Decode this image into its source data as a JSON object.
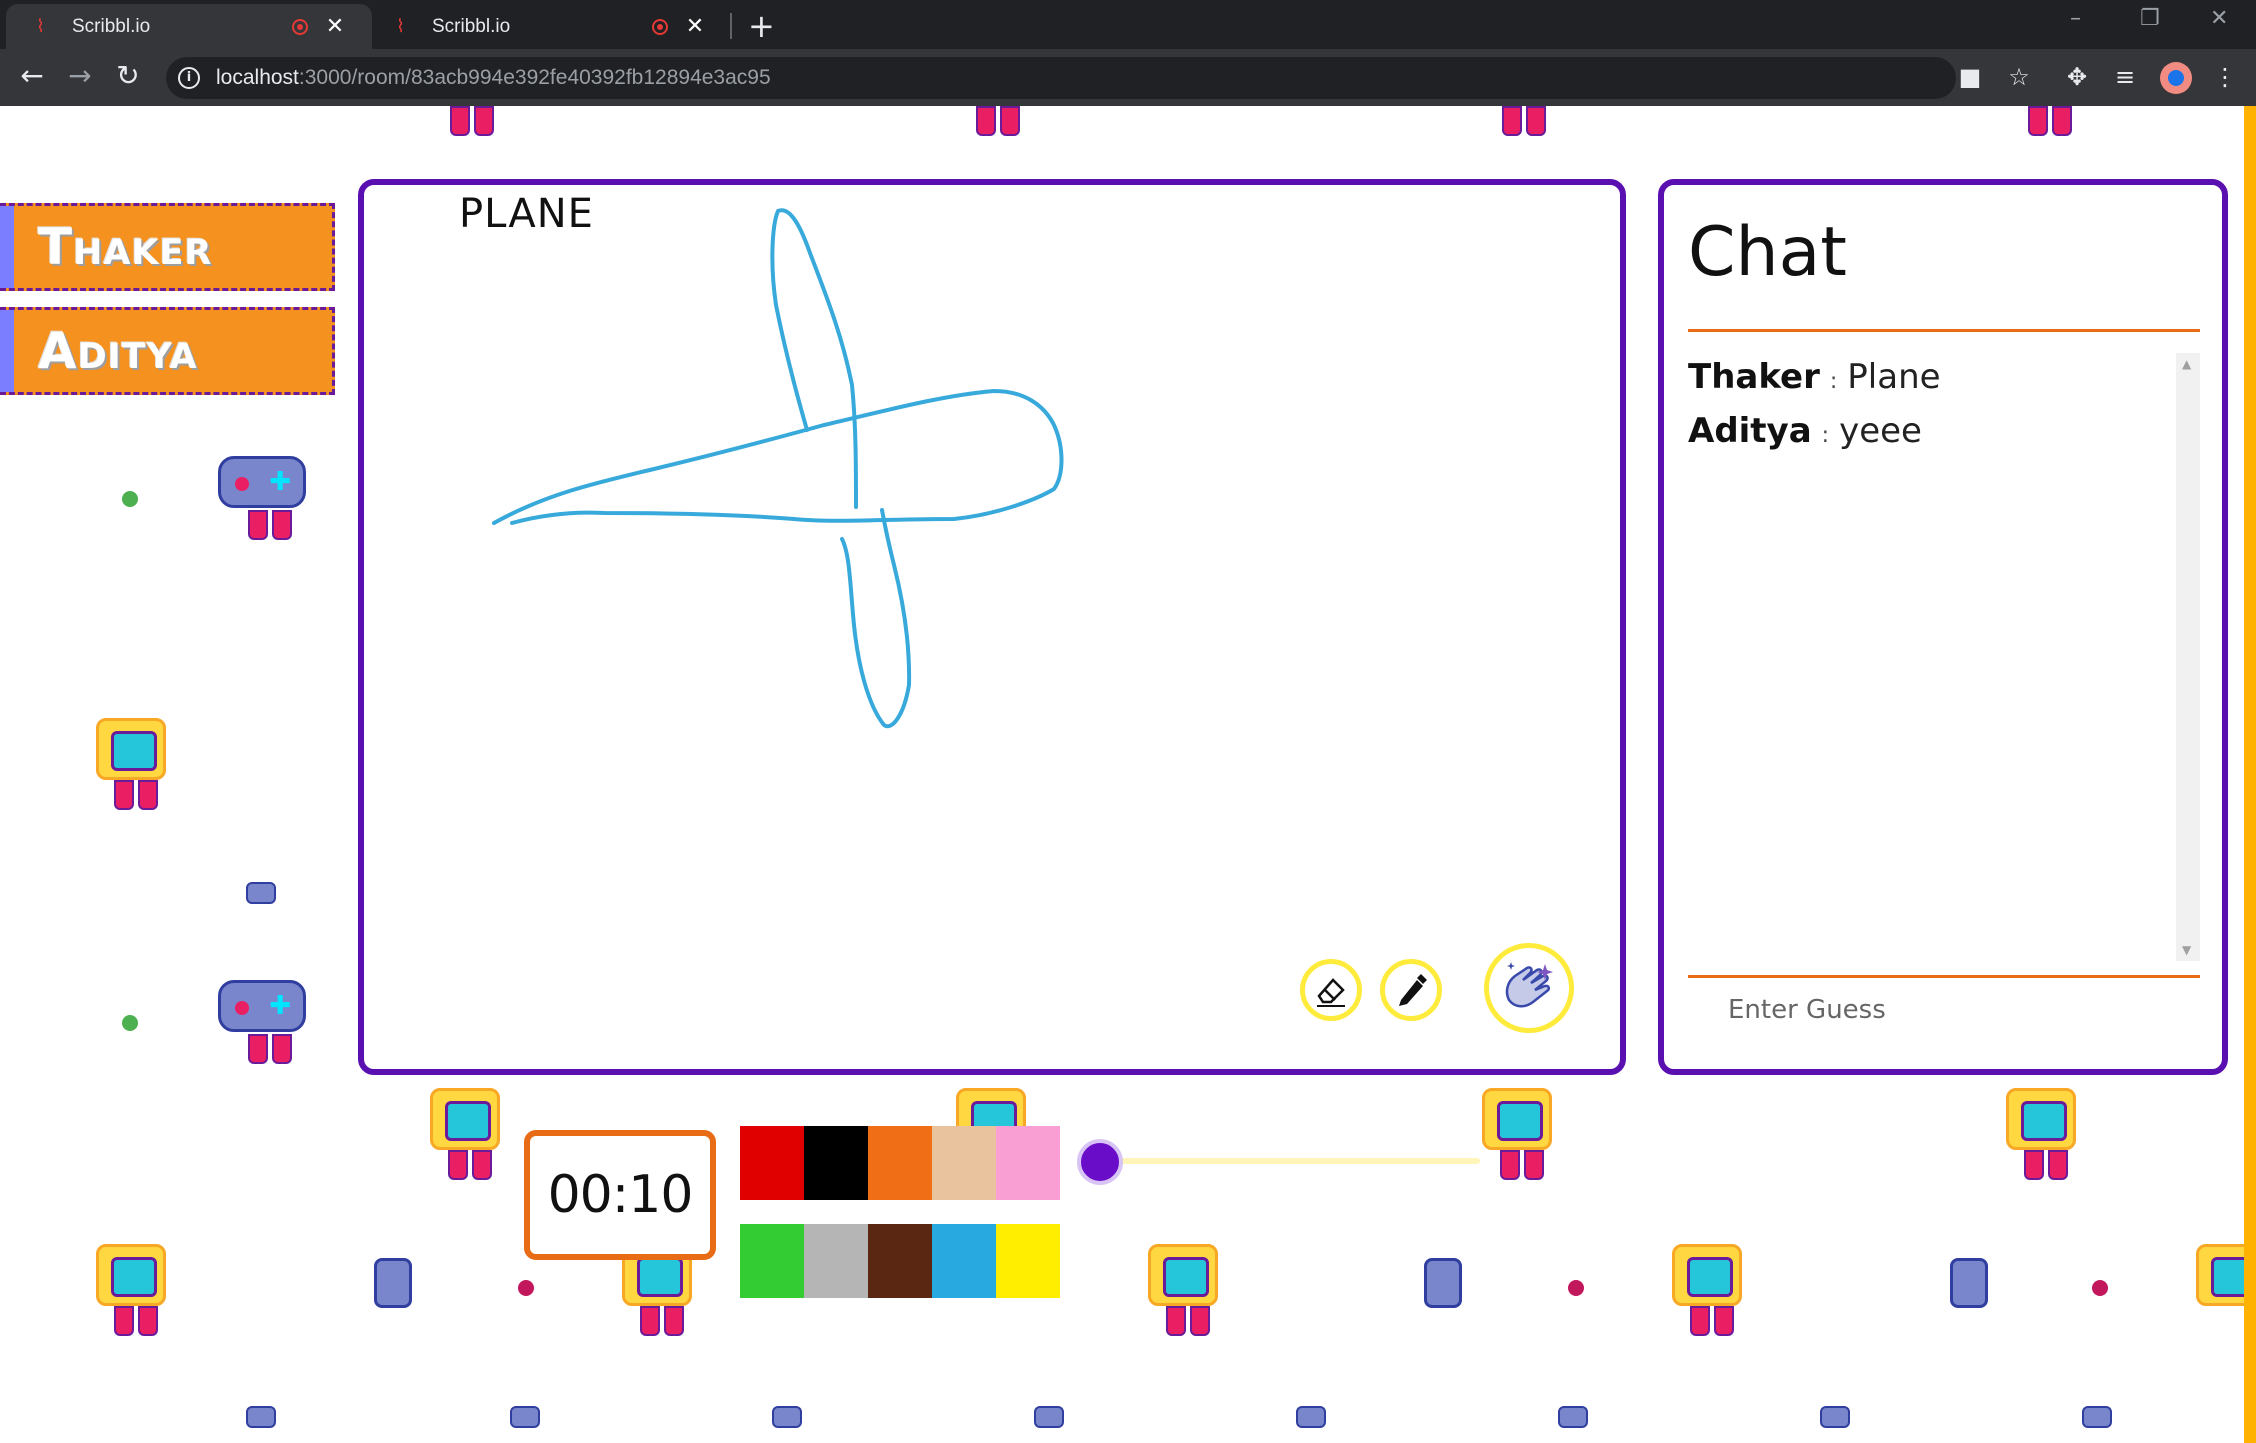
{
  "browser": {
    "tabs": [
      {
        "title": "Scribbl.io",
        "active": true
      },
      {
        "title": "Scribbl.io",
        "active": false
      }
    ],
    "url_host": "localhost",
    "url_path": ":3000/room/83acb994e392fe40392fb12894e3ac95"
  },
  "players": [
    {
      "name": "Thaker"
    },
    {
      "name": "Aditya"
    }
  ],
  "canvas": {
    "word": "PLANE",
    "stroke_color": "#38a9db"
  },
  "chat": {
    "title": "Chat",
    "messages": [
      {
        "user": "Thaker",
        "separator": ":",
        "text": "Plane"
      },
      {
        "user": "Aditya",
        "separator": ":",
        "text": "yeee"
      }
    ],
    "input_placeholder": "Enter Guess"
  },
  "timer": {
    "value": "00:10"
  },
  "palette": {
    "colors": [
      "#e00000",
      "#000000",
      "#f06e15",
      "#e8c39e",
      "#fa9fd3",
      "#33cc33",
      "#b5b5b5",
      "#5a2713",
      "#28a9e0",
      "#ffee00"
    ]
  },
  "brush_size": {
    "level": 0.05
  },
  "theme": {
    "accent": "#5a0fb0",
    "orange": "#f5911e"
  }
}
